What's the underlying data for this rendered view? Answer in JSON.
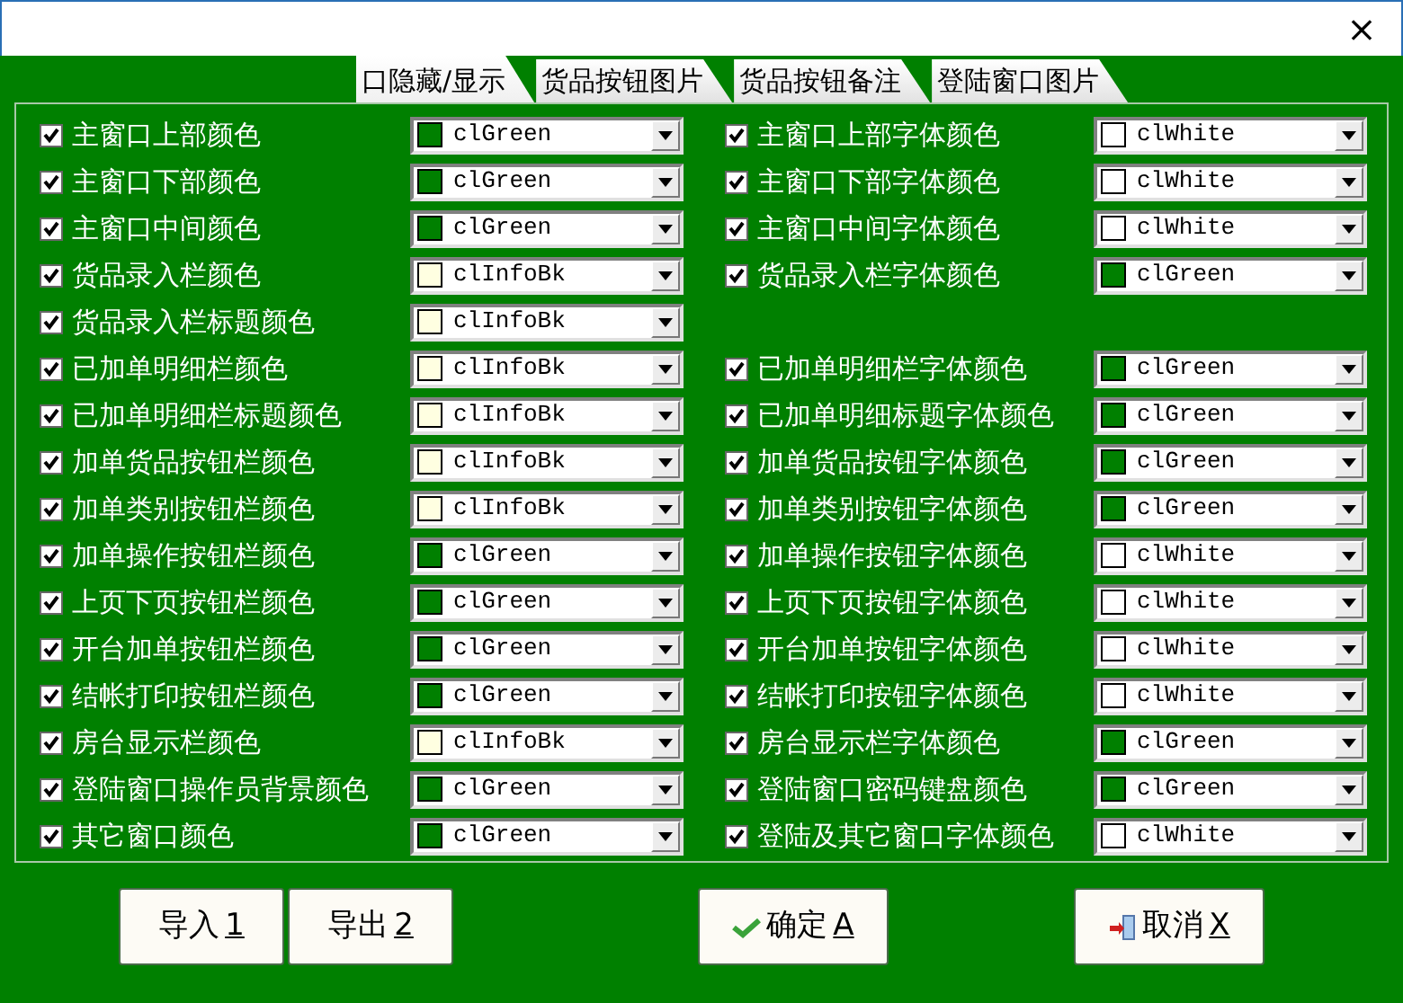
{
  "window": {
    "close": "×"
  },
  "tabs": [
    {
      "label": "口隐藏/显示",
      "selected": true
    },
    {
      "label": "货品按钮图片",
      "selected": false
    },
    {
      "label": "货品按钮备注",
      "selected": false
    },
    {
      "label": "登陆窗口图片",
      "selected": false
    }
  ],
  "rows": [
    {
      "left": {
        "label": "主窗口上部颜色",
        "checked": true,
        "value": "clGreen",
        "color": "#008000"
      },
      "right": {
        "label": "主窗口上部字体颜色",
        "checked": true,
        "value": "clWhite",
        "color": "#ffffff"
      }
    },
    {
      "left": {
        "label": "主窗口下部颜色",
        "checked": true,
        "value": "clGreen",
        "color": "#008000"
      },
      "right": {
        "label": "主窗口下部字体颜色",
        "checked": true,
        "value": "clWhite",
        "color": "#ffffff"
      }
    },
    {
      "left": {
        "label": "主窗口中间颜色",
        "checked": true,
        "value": "clGreen",
        "color": "#008000"
      },
      "right": {
        "label": "主窗口中间字体颜色",
        "checked": true,
        "value": "clWhite",
        "color": "#ffffff"
      }
    },
    {
      "left": {
        "label": "货品录入栏颜色",
        "checked": true,
        "value": "clInfoBk",
        "color": "#ffffe1"
      },
      "right": {
        "label": "货品录入栏字体颜色",
        "checked": true,
        "value": "clGreen",
        "color": "#008000"
      }
    },
    {
      "left": {
        "label": "货品录入栏标题颜色",
        "checked": true,
        "value": "clInfoBk",
        "color": "#ffffe1"
      }
    },
    {
      "left": {
        "label": "已加单明细栏颜色",
        "checked": true,
        "value": "clInfoBk",
        "color": "#ffffe1"
      },
      "right": {
        "label": "已加单明细栏字体颜色",
        "checked": true,
        "value": "clGreen",
        "color": "#008000"
      }
    },
    {
      "left": {
        "label": "已加单明细栏标题颜色",
        "checked": true,
        "value": "clInfoBk",
        "color": "#ffffe1"
      },
      "right": {
        "label": "已加单明细标题字体颜色",
        "checked": true,
        "value": "clGreen",
        "color": "#008000"
      }
    },
    {
      "left": {
        "label": "加单货品按钮栏颜色",
        "checked": true,
        "value": "clInfoBk",
        "color": "#ffffe1"
      },
      "right": {
        "label": "加单货品按钮字体颜色",
        "checked": true,
        "value": "clGreen",
        "color": "#008000"
      }
    },
    {
      "left": {
        "label": "加单类别按钮栏颜色",
        "checked": true,
        "value": "clInfoBk",
        "color": "#ffffe1"
      },
      "right": {
        "label": "加单类别按钮字体颜色",
        "checked": true,
        "value": "clGreen",
        "color": "#008000"
      }
    },
    {
      "left": {
        "label": "加单操作按钮栏颜色",
        "checked": true,
        "value": "clGreen",
        "color": "#008000"
      },
      "right": {
        "label": "加单操作按钮字体颜色",
        "checked": true,
        "value": "clWhite",
        "color": "#ffffff"
      }
    },
    {
      "left": {
        "label": "上页下页按钮栏颜色",
        "checked": true,
        "value": "clGreen",
        "color": "#008000"
      },
      "right": {
        "label": "上页下页按钮字体颜色",
        "checked": true,
        "value": "clWhite",
        "color": "#ffffff"
      }
    },
    {
      "left": {
        "label": "开台加单按钮栏颜色",
        "checked": true,
        "value": "clGreen",
        "color": "#008000"
      },
      "right": {
        "label": "开台加单按钮字体颜色",
        "checked": true,
        "value": "clWhite",
        "color": "#ffffff"
      }
    },
    {
      "left": {
        "label": "结帐打印按钮栏颜色",
        "checked": true,
        "value": "clGreen",
        "color": "#008000"
      },
      "right": {
        "label": "结帐打印按钮字体颜色",
        "checked": true,
        "value": "clWhite",
        "color": "#ffffff"
      }
    },
    {
      "left": {
        "label": "房台显示栏颜色",
        "checked": true,
        "value": "clInfoBk",
        "color": "#ffffe1"
      },
      "right": {
        "label": "房台显示栏字体颜色",
        "checked": true,
        "value": "clGreen",
        "color": "#008000"
      }
    },
    {
      "left": {
        "label": "登陆窗口操作员背景颜色",
        "checked": true,
        "value": "clGreen",
        "color": "#008000"
      },
      "right": {
        "label": "登陆窗口密码键盘颜色",
        "checked": true,
        "value": "clGreen",
        "color": "#008000"
      }
    },
    {
      "left": {
        "label": "其它窗口颜色",
        "checked": true,
        "value": "clGreen",
        "color": "#008000"
      },
      "right": {
        "label": "登陆及其它窗口字体颜色",
        "checked": true,
        "value": "clWhite",
        "color": "#ffffff"
      }
    }
  ],
  "buttons": [
    {
      "label": "导入",
      "accel": "1",
      "kind": "plain"
    },
    {
      "label": "导出",
      "accel": "2",
      "kind": "plain"
    },
    {
      "label": "确定",
      "accel": "A",
      "kind": "ok"
    },
    {
      "label": "取消",
      "accel": "X",
      "kind": "cancel"
    }
  ]
}
